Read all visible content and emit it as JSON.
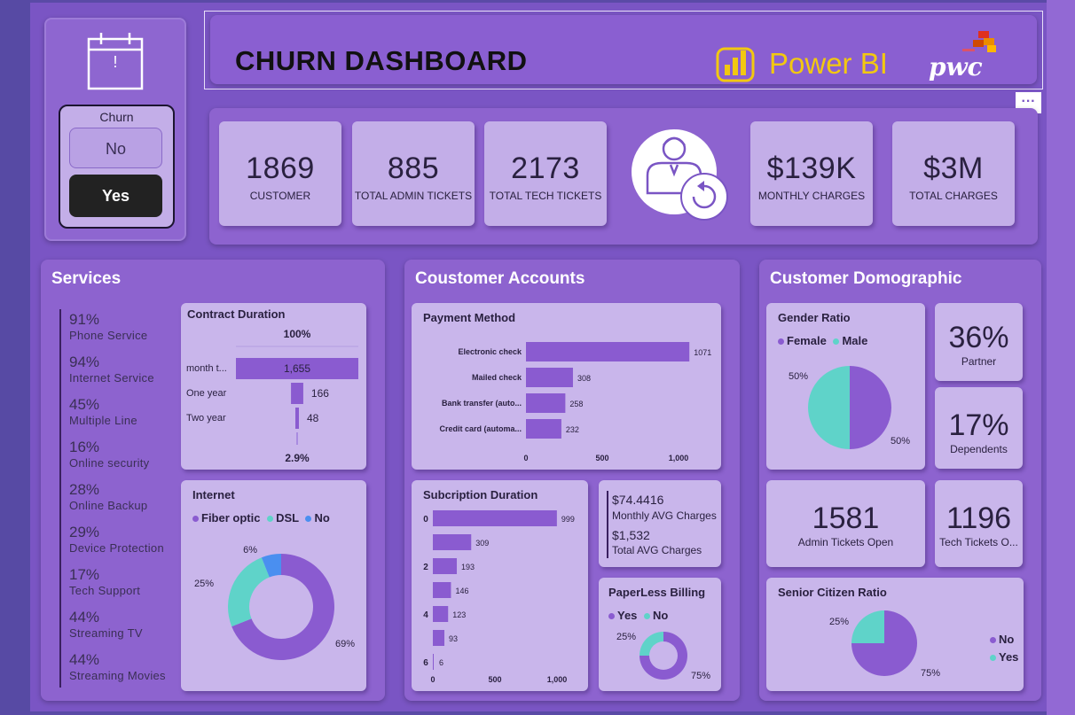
{
  "header": {
    "title": "CHURN DASHBOARD",
    "powerbi_label": "Power BI",
    "pwc_label": "pwc",
    "more_label": "···"
  },
  "slicer": {
    "title": "Churn",
    "options": [
      "No",
      "Yes"
    ],
    "selected": "Yes",
    "calendar_mark": "!"
  },
  "kpis": {
    "customer": {
      "value": "1869",
      "label": "CUSTOMER"
    },
    "admin": {
      "value": "885",
      "label": "TOTAL ADMIN TICKETS"
    },
    "tech": {
      "value": "2173",
      "label": "TOTAL TECH TICKETS"
    },
    "monthly": {
      "value": "$139K",
      "label": "MONTHLY CHARGES"
    },
    "total": {
      "value": "$3M",
      "label": "TOTAL CHARGES"
    }
  },
  "services": {
    "title": "Services",
    "items": [
      {
        "pct": "91%",
        "label": "Phone Service"
      },
      {
        "pct": "94%",
        "label": "Internet Service"
      },
      {
        "pct": "45%",
        "label": "Multiple Line"
      },
      {
        "pct": "16%",
        "label": "Online security"
      },
      {
        "pct": "28%",
        "label": "Online Backup"
      },
      {
        "pct": "29%",
        "label": "Device Protection"
      },
      {
        "pct": "17%",
        "label": "Tech Support"
      },
      {
        "pct": "44%",
        "label": "Streaming TV"
      },
      {
        "pct": "44%",
        "label": "Streaming Movies"
      }
    ]
  },
  "accounts": {
    "title": "Coustomer Accounts"
  },
  "demographic": {
    "title": "Customer Domographic"
  },
  "avg": {
    "monthly_value": "$74.4416",
    "monthly_label": "Monthly AVG Charges",
    "total_value": "$1,532",
    "total_label": "Total AVG Charges"
  },
  "partner": {
    "value": "36%",
    "label": "Partner"
  },
  "dependents": {
    "value": "17%",
    "label": "Dependents"
  },
  "admin_open": {
    "value": "1581",
    "label": "Admin Tickets Open"
  },
  "tech_open": {
    "value": "1196",
    "label": "Tech Tickets O..."
  },
  "chart_data": [
    {
      "id": "contract",
      "type": "bar",
      "title": "Contract Duration",
      "categories": [
        "month t...",
        "One year",
        "Two year"
      ],
      "values": [
        1655,
        166,
        48
      ],
      "value_labels": [
        "1,655",
        "166",
        "48"
      ],
      "top_label": "100%",
      "bottom_label": "2.9%",
      "color": "#8a5bd0"
    },
    {
      "id": "payment",
      "type": "bar",
      "title": "Payment Method",
      "categories": [
        "Electronic check",
        "Mailed check",
        "Bank transfer (auto...",
        "Credit card (automa..."
      ],
      "values": [
        1071,
        308,
        258,
        232
      ],
      "xticks": [
        "0",
        "500",
        "1,000"
      ],
      "xlim": [
        0,
        1250
      ],
      "color": "#8a5bd0"
    },
    {
      "id": "subscription",
      "type": "bar",
      "title": "Subcription Duration",
      "categories": [
        "0",
        "1",
        "2",
        "3",
        "4",
        "5",
        "6"
      ],
      "category_labels": [
        "0",
        "",
        "2",
        "",
        "4",
        "",
        "6"
      ],
      "values": [
        999,
        309,
        193,
        146,
        123,
        93,
        6
      ],
      "xticks": [
        "0",
        "500",
        "1,000"
      ],
      "xlim": [
        0,
        1000
      ],
      "color": "#8a5bd0"
    },
    {
      "id": "internet",
      "type": "pie",
      "title": "Internet",
      "donut": true,
      "labels": [
        "Fiber optic",
        "DSL",
        "No"
      ],
      "values": [
        69,
        25,
        6
      ],
      "slice_labels": [
        "69%",
        "25%",
        "6%"
      ],
      "colors": [
        "#8a5bd0",
        "#5fd3c9",
        "#4a8ff0"
      ]
    },
    {
      "id": "paperless",
      "type": "pie",
      "title": "PaperLess Billing",
      "donut": true,
      "labels": [
        "Yes",
        "No"
      ],
      "values": [
        75,
        25
      ],
      "slice_labels": [
        "75%",
        "25%"
      ],
      "colors": [
        "#8a5bd0",
        "#5fd3c9"
      ]
    },
    {
      "id": "gender",
      "type": "pie",
      "title": "Gender Ratio",
      "labels": [
        "Female",
        "Male"
      ],
      "values": [
        50,
        50
      ],
      "slice_labels": [
        "50%",
        "50%"
      ],
      "colors": [
        "#8a5bd0",
        "#5fd3c9"
      ]
    },
    {
      "id": "senior",
      "type": "pie",
      "title": "Senior Citizen Ratio",
      "labels": [
        "No",
        "Yes"
      ],
      "values": [
        75,
        25
      ],
      "slice_labels": [
        "75%",
        "25%"
      ],
      "colors": [
        "#8a5bd0",
        "#5fd3c9"
      ]
    }
  ]
}
